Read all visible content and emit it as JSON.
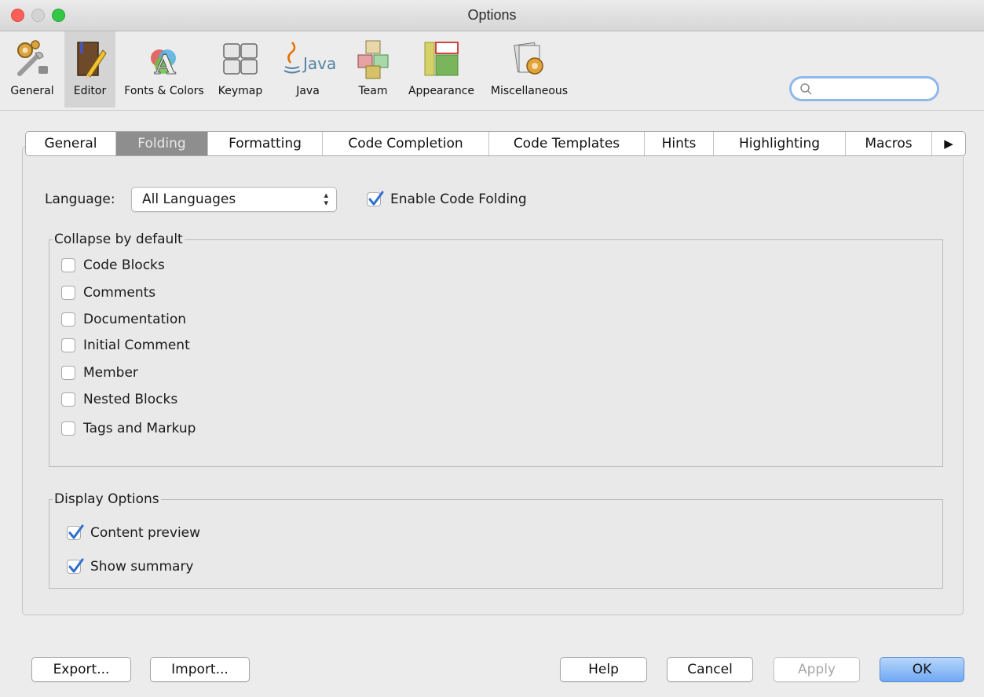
{
  "window": {
    "title": "Options"
  },
  "toolbar": {
    "categories": [
      {
        "label": "General",
        "icon": "gears-wrench-icon"
      },
      {
        "label": "Editor",
        "icon": "book-pencil-icon"
      },
      {
        "label": "Fonts & Colors",
        "icon": "fonts-colors-icon"
      },
      {
        "label": "Keymap",
        "icon": "keyboard-keys-icon"
      },
      {
        "label": "Java",
        "icon": "java-logo-icon"
      },
      {
        "label": "Team",
        "icon": "team-cubes-icon"
      },
      {
        "label": "Appearance",
        "icon": "appearance-layout-icon"
      },
      {
        "label": "Miscellaneous",
        "icon": "miscellaneous-gear-icon"
      }
    ],
    "selected": "Editor",
    "java_wordmark": "Java",
    "search_placeholder": ""
  },
  "tabs": {
    "items": [
      "General",
      "Folding",
      "Formatting",
      "Code Completion",
      "Code Templates",
      "Hints",
      "Highlighting",
      "Macros"
    ],
    "selected": "Folding",
    "more_glyph": "▶"
  },
  "folding": {
    "language_label": "Language:",
    "language_value": "All Languages",
    "enable_label": "Enable Code Folding",
    "enable_checked": true,
    "collapse_group": {
      "title": "Collapse by default",
      "items": [
        {
          "label": "Code Blocks",
          "checked": false
        },
        {
          "label": "Comments",
          "checked": false
        },
        {
          "label": "Documentation",
          "checked": false
        },
        {
          "label": "Initial Comment",
          "checked": false
        },
        {
          "label": "Member",
          "checked": false
        },
        {
          "label": "Nested Blocks",
          "checked": false
        },
        {
          "label": "Tags and Markup",
          "checked": false
        }
      ]
    },
    "display_group": {
      "title": "Display Options",
      "items": [
        {
          "label": "Content preview",
          "checked": true
        },
        {
          "label": "Show summary",
          "checked": true
        }
      ]
    }
  },
  "buttons": {
    "export": "Export...",
    "import": "Import...",
    "help": "Help",
    "cancel": "Cancel",
    "apply": "Apply",
    "ok": "OK"
  },
  "colors": {
    "accent": "#2f7de1",
    "selected_tab": "#8e8e8e",
    "close": "#fc5f57",
    "maximize": "#33c748"
  }
}
